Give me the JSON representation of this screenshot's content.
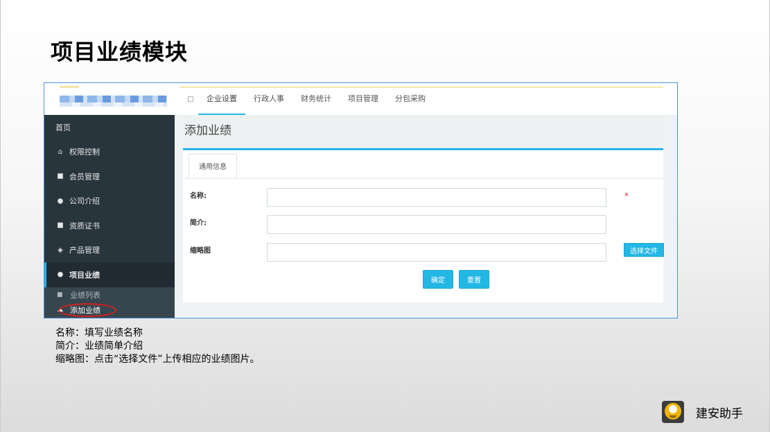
{
  "slide": {
    "title": "项目业绩模块",
    "notes": [
      "名称：填写业绩名称",
      "简介：业绩简单介绍",
      "缩略图：点击“选择文件”上传相应的业绩图片。"
    ],
    "logo_text": "建安助手"
  },
  "app": {
    "nav": {
      "toggle_icon": "square-icon",
      "items": [
        {
          "label": "企业设置",
          "active": true
        },
        {
          "label": "行政人事",
          "active": false
        },
        {
          "label": "财务统计",
          "active": false
        },
        {
          "label": "项目管理",
          "active": false
        },
        {
          "label": "分包采购",
          "active": false
        }
      ]
    },
    "sidebar": {
      "items": [
        {
          "label": "首页",
          "icon": ""
        },
        {
          "label": "权限控制",
          "icon": "home-icon"
        },
        {
          "label": "会员管理",
          "icon": "comment-icon"
        },
        {
          "label": "公司介绍",
          "icon": "lightbulb-icon"
        },
        {
          "label": "资质证书",
          "icon": "comment-icon"
        },
        {
          "label": "产品管理",
          "icon": "tag-icon"
        },
        {
          "label": "项目业绩",
          "icon": "lightbulb-icon"
        }
      ],
      "sub_items": [
        {
          "label": "业绩列表",
          "icon": "comment-icon"
        },
        {
          "label": "添加业绩",
          "icon": "cloud-icon"
        }
      ]
    },
    "page": {
      "title": "添加业绩",
      "tab_label": "通用信息",
      "fields": {
        "name_label": "名称:",
        "intro_label": "简介:",
        "thumb_label": "缩略图"
      },
      "required_mark": "*",
      "file_button": "选择文件",
      "confirm_button": "确定",
      "reset_button": "重置"
    },
    "colors": {
      "accent": "#23b7e5",
      "sidebar_bg": "#29353d",
      "highlight_circle": "#d62020"
    }
  }
}
